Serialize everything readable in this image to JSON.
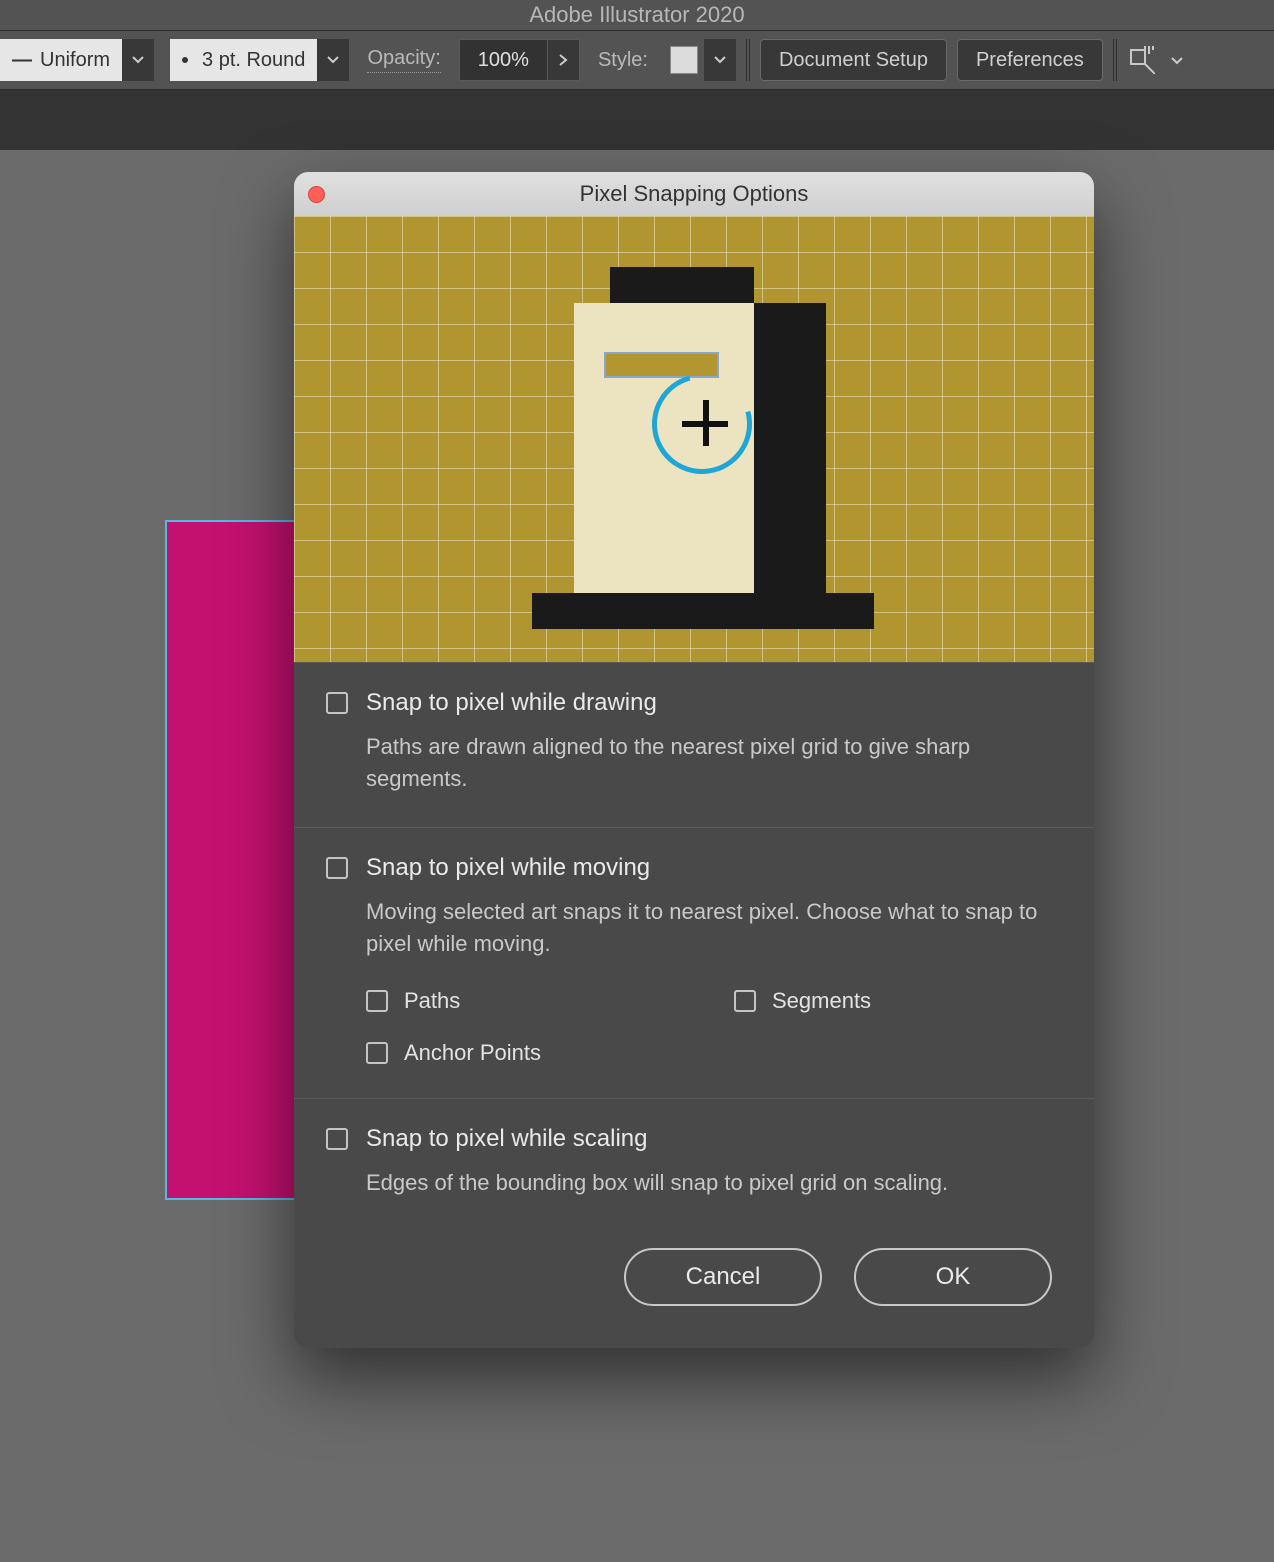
{
  "app": {
    "title": "Adobe Illustrator 2020"
  },
  "toolbar": {
    "stroke_profile": "Uniform",
    "stroke_style": "3 pt. Round",
    "opacity_label": "Opacity:",
    "opacity_value": "100%",
    "style_label": "Style:",
    "doc_setup": "Document Setup",
    "preferences": "Preferences"
  },
  "dialog": {
    "title": "Pixel Snapping Options",
    "sections": [
      {
        "title": "Snap to pixel while drawing",
        "desc": "Paths are drawn aligned to the nearest pixel grid to give sharp segments."
      },
      {
        "title": "Snap to pixel while moving",
        "desc": "Moving selected art snaps it to nearest pixel. Choose what to snap to pixel while moving.",
        "subs": {
          "paths": "Paths",
          "segments": "Segments",
          "anchors": "Anchor Points"
        }
      },
      {
        "title": "Snap to pixel while scaling",
        "desc": "Edges of the bounding box will snap to pixel grid on scaling."
      }
    ],
    "cancel": "Cancel",
    "ok": "OK"
  }
}
